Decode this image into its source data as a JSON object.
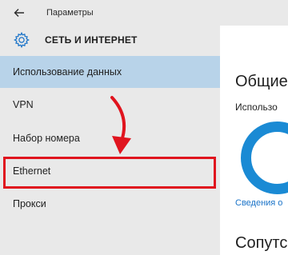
{
  "window": {
    "title": "Параметры",
    "back_icon": "back-arrow-icon"
  },
  "section": {
    "title": "СЕТЬ И ИНТЕРНЕТ",
    "icon": "gear-icon"
  },
  "sidebar": {
    "items": [
      {
        "label": "Использование данных",
        "selected": true
      },
      {
        "label": "VPN",
        "selected": false
      },
      {
        "label": "Набор номера",
        "selected": false
      },
      {
        "label": "Ethernet",
        "selected": false,
        "highlighted": true
      },
      {
        "label": "Прокси",
        "selected": false
      }
    ]
  },
  "content": {
    "heading": "Общие",
    "usage_label": "Использо",
    "details_link": "Сведения о",
    "related_heading": "Сопутс"
  },
  "colors": {
    "sidebar_bg": "#e9e9e9",
    "selected_bg": "#b8d3e9",
    "highlight": "#e0141e",
    "donut": "#1a8ad4",
    "link": "#1a73c8"
  }
}
